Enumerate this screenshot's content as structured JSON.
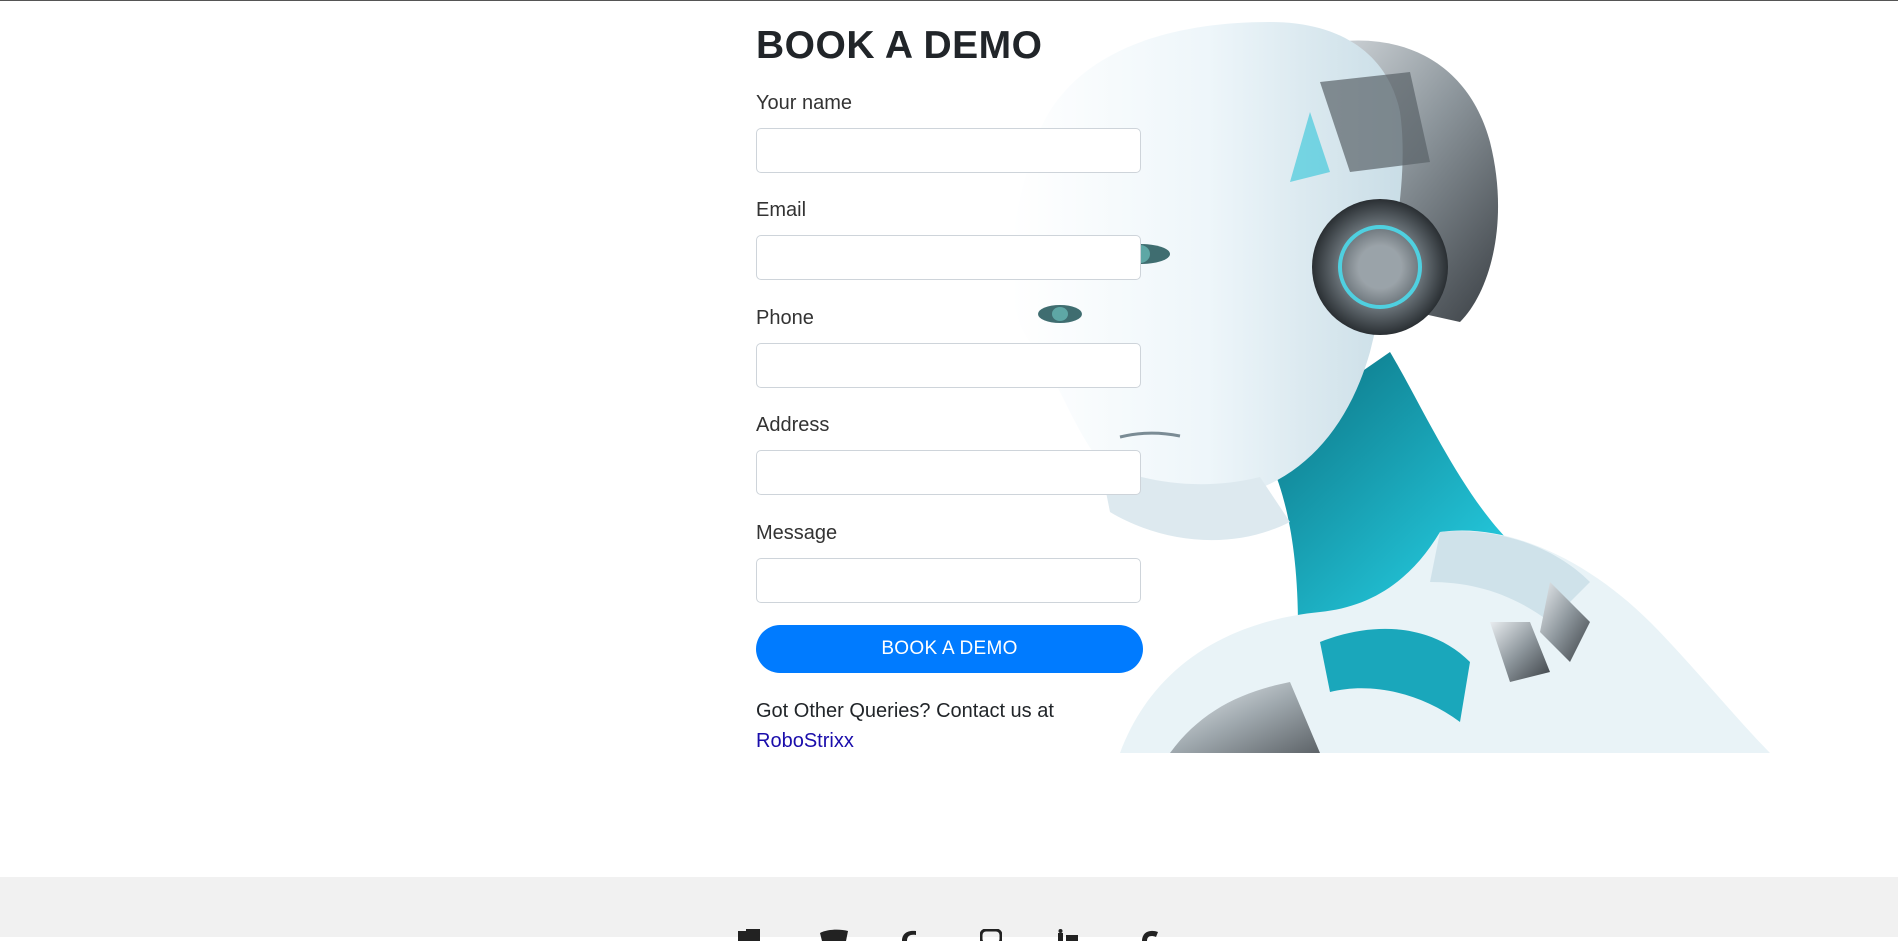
{
  "form": {
    "title": "BOOK A DEMO",
    "fields": [
      {
        "label": "Your name",
        "value": "",
        "placeholder": ""
      },
      {
        "label": "Email",
        "value": "",
        "placeholder": ""
      },
      {
        "label": "Phone",
        "value": "",
        "placeholder": ""
      },
      {
        "label": "Address",
        "value": "",
        "placeholder": ""
      },
      {
        "label": "Message",
        "value": "",
        "placeholder": ""
      }
    ],
    "submit_label": "BOOK A DEMO",
    "queries_text": "Got Other Queries? Contact us at",
    "contact_link": "RoboStrixx"
  },
  "colors": {
    "primary": "#007bff",
    "link": "#1a0dab",
    "footer_bg": "#f1f1f1",
    "robot_accent": "#19b3c6"
  },
  "footer": {
    "social_icons": [
      "facebook-icon",
      "twitter-icon",
      "google-plus-icon",
      "instagram-icon",
      "linkedin-icon",
      "skype-icon"
    ]
  }
}
